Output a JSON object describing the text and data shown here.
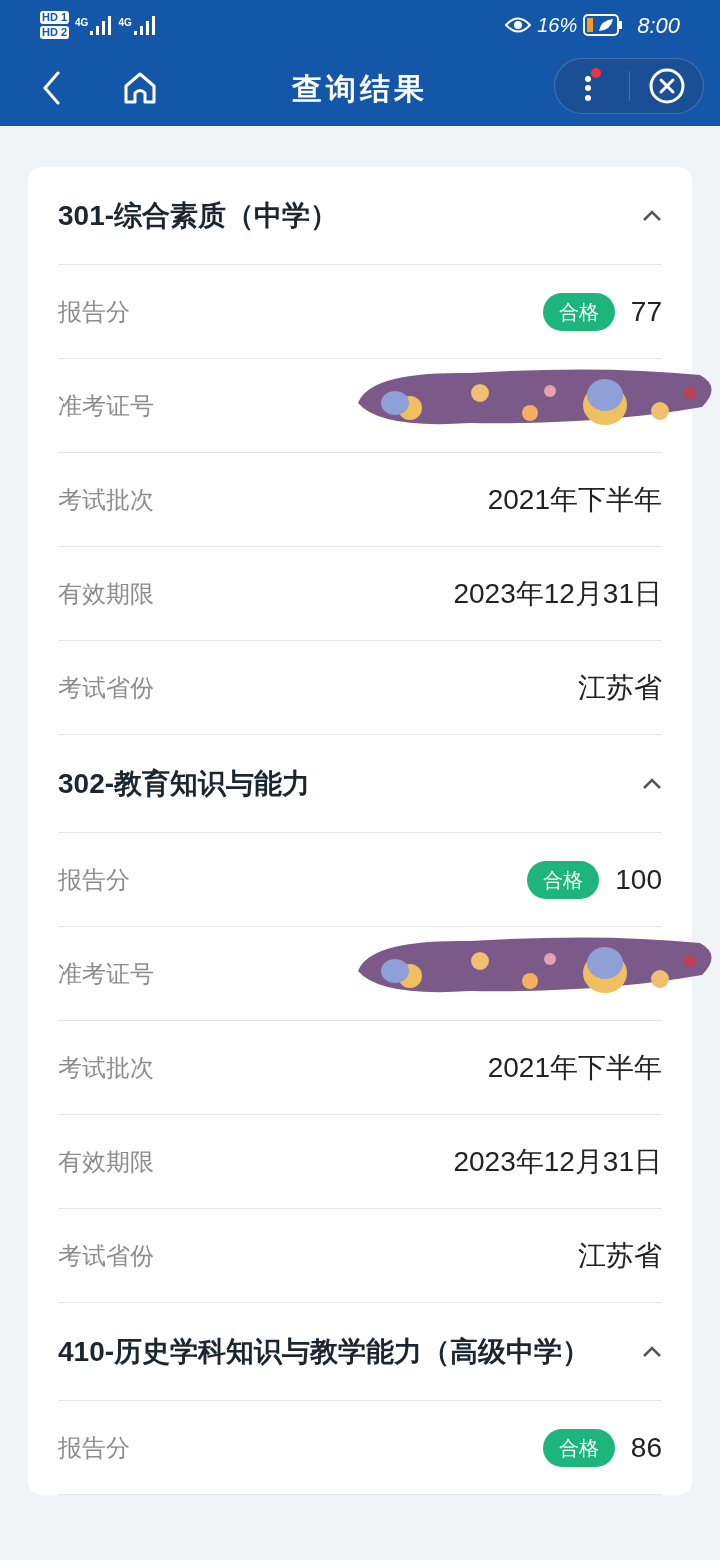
{
  "status_bar": {
    "sim_labels": [
      "HD 1",
      "HD 2"
    ],
    "networks": [
      "4G",
      "4G"
    ],
    "battery_percent": "16%",
    "time": "8:00"
  },
  "header": {
    "title": "查询结果"
  },
  "sections": [
    {
      "title": "301-综合素质（中学）",
      "expanded": true,
      "rows": [
        {
          "kind": "score",
          "label": "报告分",
          "badge": "合格",
          "value": "77"
        },
        {
          "kind": "covered",
          "label": "准考证号"
        },
        {
          "kind": "text",
          "label": "考试批次",
          "value": "2021年下半年"
        },
        {
          "kind": "text",
          "label": "有效期限",
          "value": "2023年12月31日"
        },
        {
          "kind": "text",
          "label": "考试省份",
          "value": "江苏省"
        }
      ]
    },
    {
      "title": "302-教育知识与能力",
      "expanded": true,
      "rows": [
        {
          "kind": "score",
          "label": "报告分",
          "badge": "合格",
          "value": "100"
        },
        {
          "kind": "covered",
          "label": "准考证号"
        },
        {
          "kind": "text",
          "label": "考试批次",
          "value": "2021年下半年"
        },
        {
          "kind": "text",
          "label": "有效期限",
          "value": "2023年12月31日"
        },
        {
          "kind": "text",
          "label": "考试省份",
          "value": "江苏省"
        }
      ]
    },
    {
      "title": "410-历史学科知识与教学能力（高级中学）",
      "expanded": true,
      "rows": [
        {
          "kind": "score",
          "label": "报告分",
          "badge": "合格",
          "value": "86"
        }
      ]
    }
  ]
}
